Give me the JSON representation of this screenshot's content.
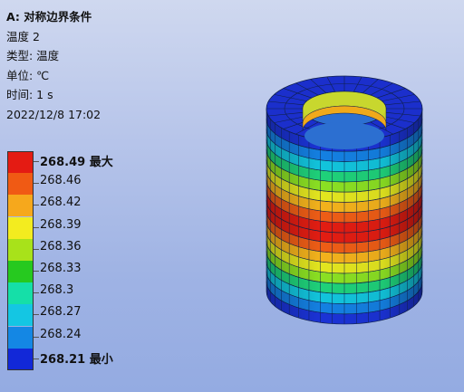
{
  "info": {
    "title": "A: 对称边界条件",
    "result": "温度 2",
    "type": "类型: 温度",
    "unit": "单位: ℃",
    "time": "时间: 1 s",
    "date": "2022/12/8 17:02"
  },
  "legend": {
    "max_suffix": "最大",
    "min_suffix": "最小",
    "items": [
      {
        "value": "268.49",
        "color": "#e41b13"
      },
      {
        "value": "268.46",
        "color": "#f05a14"
      },
      {
        "value": "268.42",
        "color": "#f6a81c"
      },
      {
        "value": "268.39",
        "color": "#f3ec1f"
      },
      {
        "value": "268.36",
        "color": "#a8e21a"
      },
      {
        "value": "268.33",
        "color": "#26c91f"
      },
      {
        "value": "268.3",
        "color": "#15dfa8"
      },
      {
        "value": "268.27",
        "color": "#14c6e3"
      },
      {
        "value": "268.24",
        "color": "#1487e4"
      },
      {
        "value": "268.21",
        "color": "#1228d8"
      }
    ]
  },
  "model": {
    "band_colors": [
      "#1b33d6",
      "#1480e2",
      "#12c4dc",
      "#1fd17a",
      "#8be023",
      "#e3e61f",
      "#f3b21c",
      "#ee5d16",
      "#e21d12",
      "#e21d12",
      "#ee5d16",
      "#f3b21c",
      "#e3e61f",
      "#8be023",
      "#1fd17a",
      "#12c4dc",
      "#1480e2",
      "#1b33d6"
    ],
    "top_color": "#1b2fcc",
    "inner_color": "#2c6fd1",
    "edge_color": "#10204a"
  }
}
